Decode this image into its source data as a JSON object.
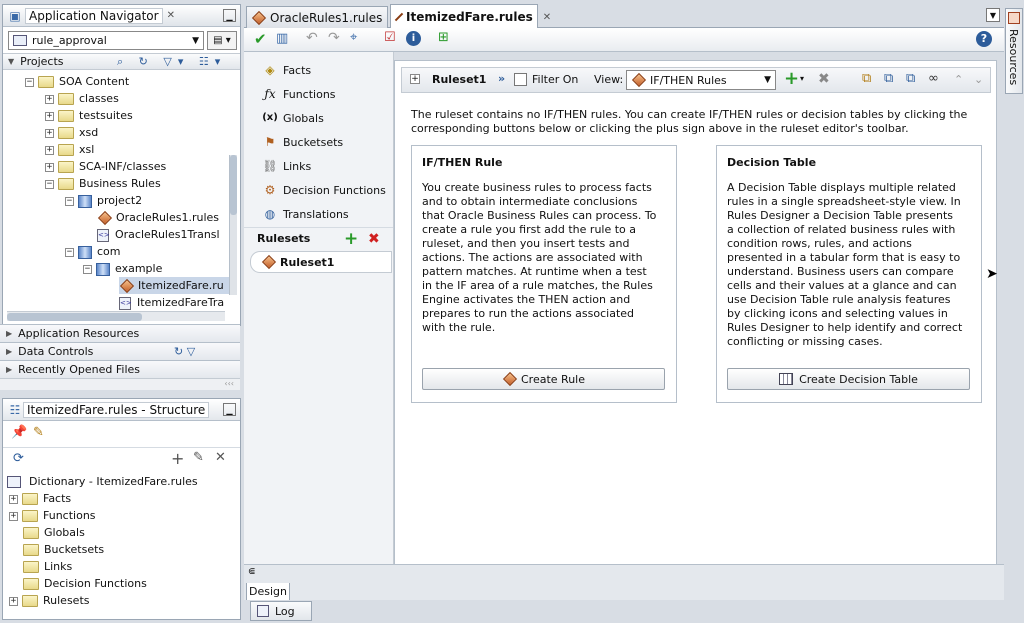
{
  "navigator": {
    "title": "Application Navigator",
    "app": "rule_approval",
    "projects": "Projects",
    "tree": [
      "SOA Content",
      "classes",
      "testsuites",
      "xsd",
      "xsl",
      "SCA-INF/classes",
      "Business Rules",
      "project2",
      "OracleRules1.rules",
      "OracleRules1Transl",
      "com",
      "example",
      "ItemizedFare.ru",
      "ItemizedFareTra"
    ]
  },
  "accordions": [
    "Application Resources",
    "Data Controls",
    "Recently Opened Files"
  ],
  "structure": {
    "title": "ItemizedFare.rules - Structure",
    "root": "Dictionary - ItemizedFare.rules",
    "items": [
      "Facts",
      "Functions",
      "Globals",
      "Bucketsets",
      "Links",
      "Decision Functions",
      "Rulesets"
    ]
  },
  "tabs": [
    "OracleRules1.rules",
    "ItemizedFare.rules"
  ],
  "side_nav": [
    "Facts",
    "Functions",
    "Globals",
    "Bucketsets",
    "Links",
    "Decision Functions",
    "Translations"
  ],
  "rulesets": {
    "label": "Rulesets",
    "item": "Ruleset1"
  },
  "ruleset_bar": {
    "name": "Ruleset1",
    "filter": "Filter On",
    "view_label": "View:",
    "view_value": "IF/THEN Rules"
  },
  "intro": "The ruleset contains no IF/THEN rules. You can create IF/THEN rules or decision tables by clicking the corresponding buttons below or clicking the plus sign above in the ruleset editor's toolbar.",
  "ifthen": {
    "title": "IF/THEN Rule",
    "body": "You create business rules to process facts and to obtain intermediate conclusions that Oracle Business Rules can process. To create a rule you first add the rule to a ruleset, and then you insert tests and actions. The actions are associated with pattern matches. At runtime when a test in the IF area of a rule matches, the Rules Engine activates the THEN action and prepares to run the actions associated with the rule.",
    "button": "Create Rule"
  },
  "dtable": {
    "title": "Decision Table",
    "body": "A Decision Table displays multiple related rules in a single spreadsheet-style view. In Rules Designer a Decision Table presents a collection of related business rules with condition rows, rules, and actions presented in a tabular form that is easy to understand. Business users can compare cells and their values at a glance and can use Decision Table rule analysis features by clicking icons and selecting values in Rules Designer to help identify and correct conflicting or missing cases.",
    "button": "Create Decision Table"
  },
  "bottom": {
    "design": "Design",
    "log": "Log"
  },
  "resources": "Resources"
}
